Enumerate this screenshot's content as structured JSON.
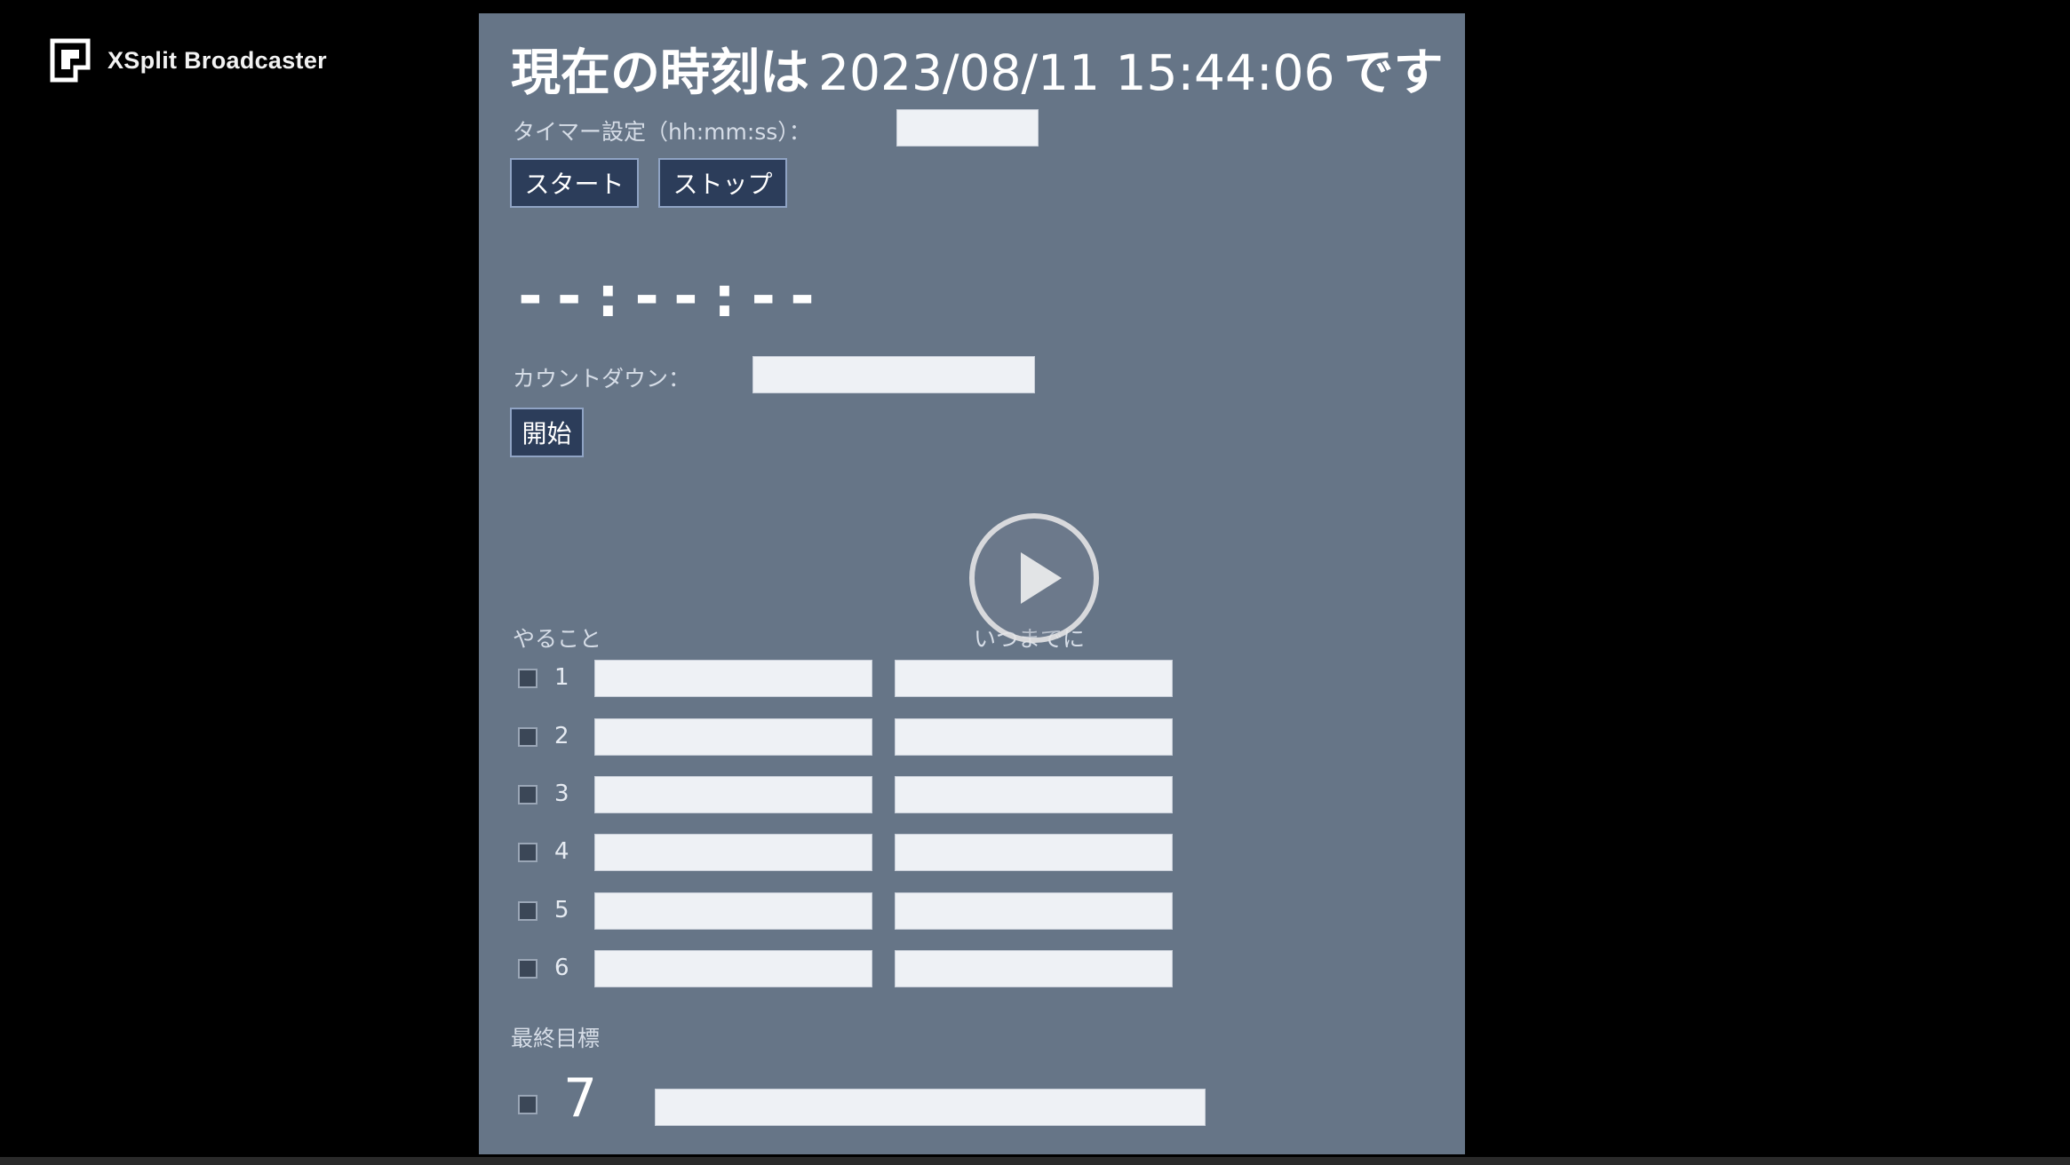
{
  "watermark": {
    "text": "XSplit Broadcaster",
    "icon": "xsplit-logo-icon"
  },
  "clock": {
    "prefix": "現在の時刻は",
    "time": "2023/08/11 15:44:06",
    "suffix": "です"
  },
  "timer": {
    "label": "タイマー設定（hh:mm:ss）：",
    "value": "",
    "start_label": "スタート",
    "stop_label": "ストップ",
    "display": "--:--:--"
  },
  "countdown": {
    "label": "カウントダウン：",
    "value": "",
    "start_label": "開始"
  },
  "tasks": {
    "header_todo": "やること",
    "header_deadline": "いつまでに",
    "rows": [
      {
        "num": "1",
        "todo": "",
        "deadline": ""
      },
      {
        "num": "2",
        "todo": "",
        "deadline": ""
      },
      {
        "num": "3",
        "todo": "",
        "deadline": ""
      },
      {
        "num": "4",
        "todo": "",
        "deadline": ""
      },
      {
        "num": "5",
        "todo": "",
        "deadline": ""
      },
      {
        "num": "6",
        "todo": "",
        "deadline": ""
      }
    ]
  },
  "goal": {
    "label": "最終目標",
    "num": "7",
    "value": ""
  },
  "player": {
    "play_icon": "play-icon"
  },
  "colors": {
    "panel_bg": "#667587",
    "page_bg": "#000000",
    "button_bg": "#2c3d5a",
    "field_bg": "#eef1f5"
  }
}
